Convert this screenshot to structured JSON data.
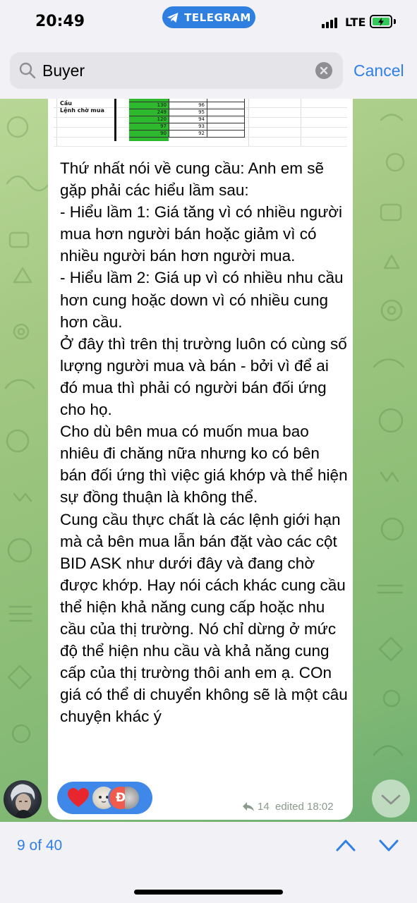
{
  "status_bar": {
    "time": "20:49",
    "app_pill": "TELEGRAM",
    "network": "LTE"
  },
  "search": {
    "value": "Buyer",
    "cancel_label": "Cancel"
  },
  "sheet_preview": {
    "row_labels": [
      "Cầu",
      "Lệnh chờ mua"
    ],
    "rows": [
      [
        "130",
        "96"
      ],
      [
        "249",
        "95"
      ],
      [
        "120",
        "94"
      ],
      [
        "97",
        "93"
      ],
      [
        "90",
        "92"
      ]
    ]
  },
  "message": {
    "text": "Thứ nhất nói về cung cầu: Anh em sẽ gặp phải các hiểu lầm sau:\n- Hiểu lầm 1: Giá tăng vì có nhiều người mua hơn người bán hoặc giảm vì có nhiều người bán hơn người mua.\n- Hiểu lầm 2: Giá up vì có nhiều nhu cầu hơn cung hoặc down vì có nhiều cung hơn cầu.\nỞ đây thì trên thị trường luôn có cùng số lượng người mua và bán - bởi vì để ai đó mua thì phải có người bán đối ứng cho họ.\nCho dù bên mua có muốn mua bao nhiêu đi chăng nữa nhưng ko có bên bán đối ứng thì việc giá khớp và thể hiện sự đồng thuận là không thể.\nCung cầu thực chất là các lệnh giới hạn mà cả bên mua lẫn bán đặt vào các cột BID ASK như dưới đây và đang chờ được khớp. Hay nói cách khác cung cầu thể hiện khả năng cung cấp hoặc nhu cầu của thị trường. Nó chỉ dừng ở mức độ thể hiện nhu cầu và khả năng cung cấp của thị trường thôi anh em ạ. COn giá có thể di chuyển không sẽ là một câu chuyện khác ý",
    "reaction_avatar_letter": "Đ",
    "reply_count": "14",
    "edited_time": "edited 18:02"
  },
  "bottom": {
    "result_counter": "9 of 40"
  },
  "colors": {
    "accent": "#2f7fe8",
    "reaction_bg": "#3f88e9",
    "chat_bg": "#9bc47f"
  }
}
